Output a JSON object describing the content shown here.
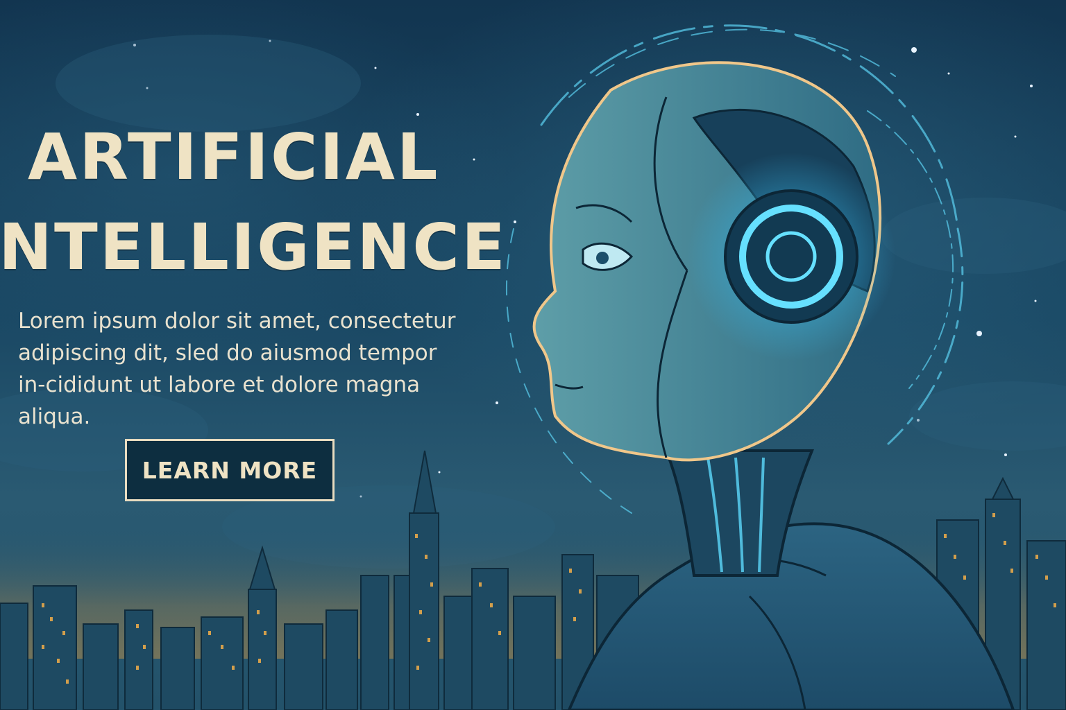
{
  "hero": {
    "headline_line1": "ARTIFICIAL",
    "headline_line2": "NTELLIGENCE",
    "body": "Lorem ipsum dolor sit amet, consectetur adipiscing dit, sled do aiusmod tempor in-cididunt ut labore et dolore magna aliqua.",
    "cta_label": "LEARN MORE"
  },
  "colors": {
    "sky_dark": "#123550",
    "sky_mid": "#1a4864",
    "headline": "#efe3c4",
    "button_bg": "#0d2e40",
    "button_border": "#e8dcc0",
    "glow": "#5fd8ff",
    "window_light": "#e7a94a"
  },
  "illustration": {
    "subject": "robot-head-profile",
    "background": "night-city-skyline"
  }
}
